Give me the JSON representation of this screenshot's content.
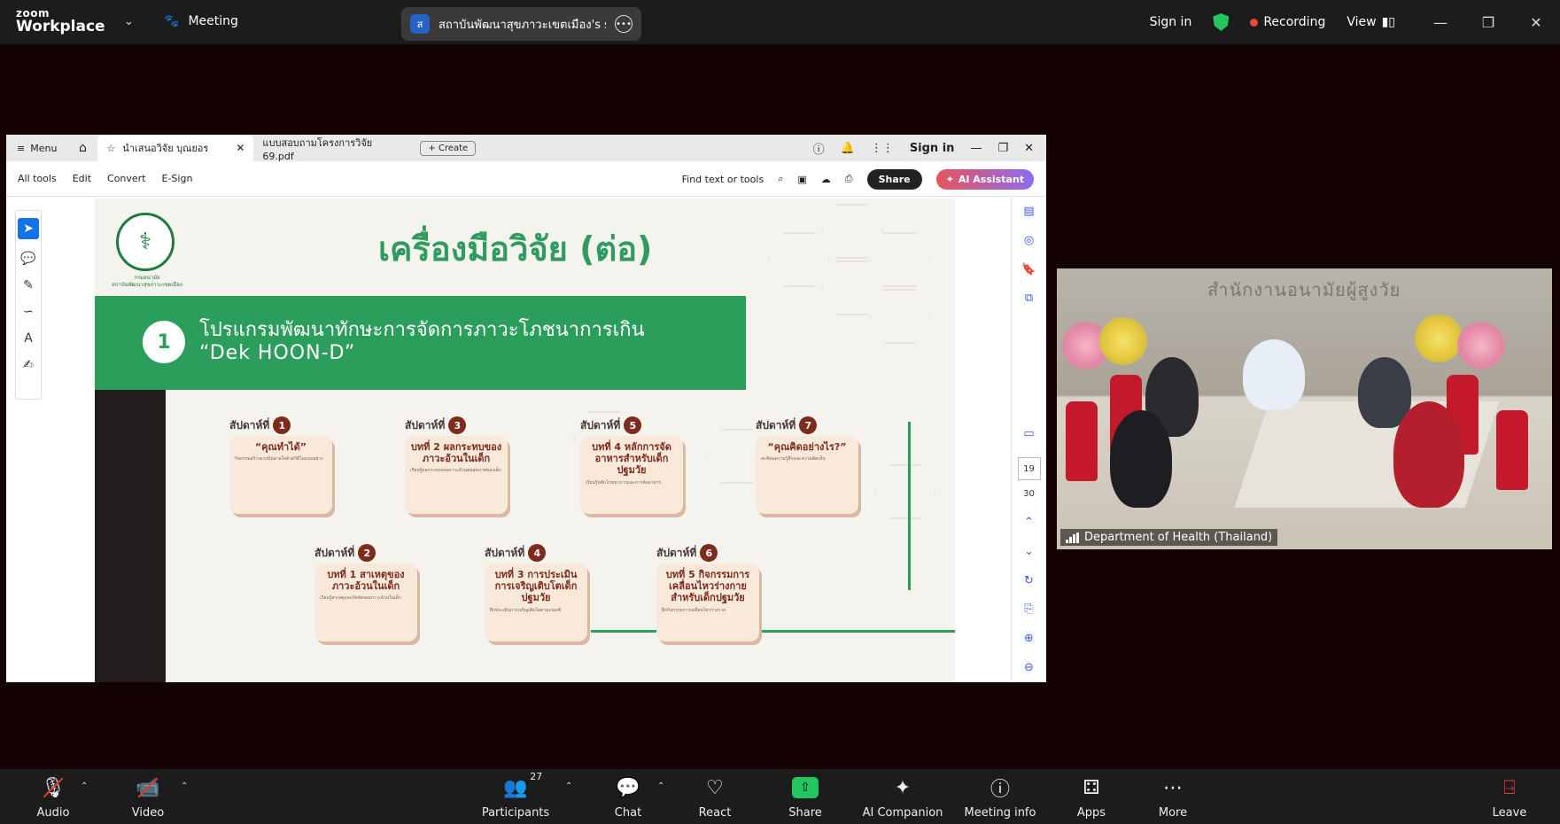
{
  "topbar": {
    "logo_top": "zoom",
    "logo_bottom": "Workplace",
    "meeting_label": "Meeting",
    "share_badge": "ส",
    "share_title": "สถาบันพัฒนาสุขภาวะเขตเมือง's scree",
    "sign_in": "Sign in",
    "recording": "Recording",
    "view": "View"
  },
  "shared_window": {
    "menu_label": "Menu",
    "tab_active": "นำเสนอวิจัย บุณยอร",
    "tab_second": "แบบสอบถามโครงการวิจัย 69.pdf",
    "create_label": "Create",
    "sign_in": "Sign in",
    "tools": [
      "All tools",
      "Edit",
      "Convert",
      "E-Sign"
    ],
    "find_label": "Find text or tools",
    "share_btn": "Share",
    "ai_btn": "AI Assistant",
    "page_current": "19",
    "page_total": "30"
  },
  "slide": {
    "title": "เครื่องมือวิจัย (ต่อ)",
    "seal_caption": "กรมอนามัย\nสถาบันพัฒนาสุขภาวะเขตเมือง",
    "banner_num": "1",
    "banner_line1": "โปรแกรมพัฒนาทักษะการจัดการภาวะโภชนาการเกิน",
    "banner_line2": "“Dek HOON-D”",
    "week_prefix": "สัปดาห์ที่",
    "weeks": [
      {
        "n": "1",
        "head": "“คุณทำได้”",
        "body": "กิจกรรมสร้างแรงบันดาลใจด้วยวิดีโอแบบอย่าง"
      },
      {
        "n": "2",
        "head": "บทที่ 1 สาเหตุของภาวะอ้วนในเด็ก",
        "body": "เรียนรู้สาเหตุและปัจจัยของภาวะอ้วนในเด็ก"
      },
      {
        "n": "3",
        "head": "บทที่ 2 ผลกระทบของภาวะอ้วนในเด็ก",
        "body": "เรียนรู้ผลกระทบของภาวะอ้วนต่อสุขภาพของเด็ก"
      },
      {
        "n": "4",
        "head": "บทที่ 3 การประเมินการเจริญเติบโตเด็กปฐมวัย",
        "body": "ฝึกประเมินการเจริญเติบโตตามเกณฑ์"
      },
      {
        "n": "5",
        "head": "บทที่ 4 หลักการจัดอาหารสำหรับเด็กปฐมวัย",
        "body": "เรียนรู้หลักโภชนาการและการจัดอาหาร"
      },
      {
        "n": "6",
        "head": "บทที่ 5 กิจกรรมการเคลื่อนไหวร่างกายสำหรับเด็กปฐมวัย",
        "body": "ฝึกกิจกรรมการเคลื่อนไหวร่างกาย"
      },
      {
        "n": "7",
        "head": "“คุณคิดอย่างไร?”",
        "body": "สะท้อนความรู้สึกและความคิดเห็น"
      }
    ]
  },
  "video": {
    "participant_name": "Department of Health (Thailand)"
  },
  "bottombar": {
    "audio": "Audio",
    "video": "Video",
    "participants": "Participants",
    "participants_count": "27",
    "chat": "Chat",
    "react": "React",
    "share": "Share",
    "ai_companion": "AI Companion",
    "meeting_info": "Meeting info",
    "apps": "Apps",
    "more": "More",
    "leave": "Leave"
  }
}
